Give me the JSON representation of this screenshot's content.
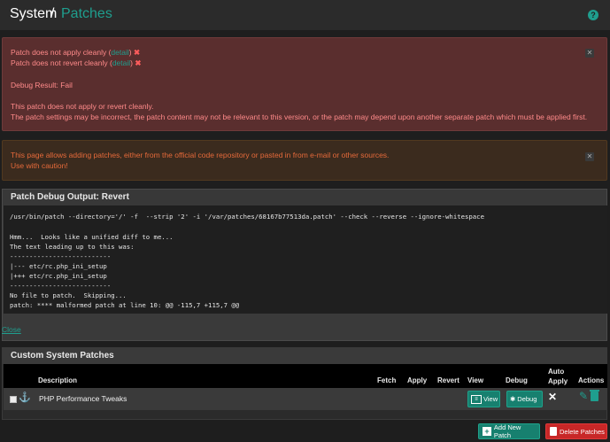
{
  "header": {
    "crumb_root": "System",
    "crumb_sep": "/",
    "crumb_leaf": "Patches",
    "help": "?"
  },
  "alert_danger": {
    "apply_text": "Patch does not apply cleanly (",
    "revert_text": "Patch does not revert cleanly (",
    "detail_link": "detail",
    "close_paren": ")",
    "debug_result": "Debug Result: Fail",
    "msg1": "This patch does not apply or revert cleanly.",
    "msg2": "The patch settings may be incorrect, the patch content may not be relevant to this version, or the patch may depend upon another separate patch which must be applied first."
  },
  "alert_warning": {
    "line1": "This page allows adding patches, either from the official code repository or pasted in from e-mail or other sources.",
    "line2": "Use with caution!"
  },
  "debug_panel": {
    "title": "Patch Debug Output: Revert",
    "lines": [
      "/usr/bin/patch --directory='/' -f  --strip '2' -i '/var/patches/68167b77513da.patch' --check --reverse --ignore-whitespace",
      "",
      "Hmm...  Looks like a unified diff to me...",
      "The text leading up to this was:",
      "--------------------------",
      "|--- etc/rc.php_ini_setup",
      "|+++ etc/rc.php_ini_setup",
      "--------------------------",
      "No file to patch.  Skipping...",
      "patch: **** malformed patch at line 10: @@ -115,7 +115,7 @@"
    ],
    "close_link": "Close"
  },
  "patches_panel": {
    "title": "Custom System Patches",
    "columns": {
      "description": "Description",
      "fetch": "Fetch",
      "apply": "Apply",
      "revert": "Revert",
      "view": "View",
      "debug": "Debug",
      "auto1": "Auto",
      "auto2": "Apply",
      "actions": "Actions"
    },
    "rows": [
      {
        "description": "PHP Performance Tweaks",
        "view_label": "View",
        "debug_label": "Debug",
        "auto_apply": "✕"
      }
    ]
  },
  "buttons": {
    "add": "Add New Patch",
    "delete": "Delete Patches"
  },
  "colors": {
    "accent": "#1f9e8e",
    "danger": "#c82727",
    "danger_text": "#ff8a8a",
    "warning_text": "#e66a3a"
  }
}
